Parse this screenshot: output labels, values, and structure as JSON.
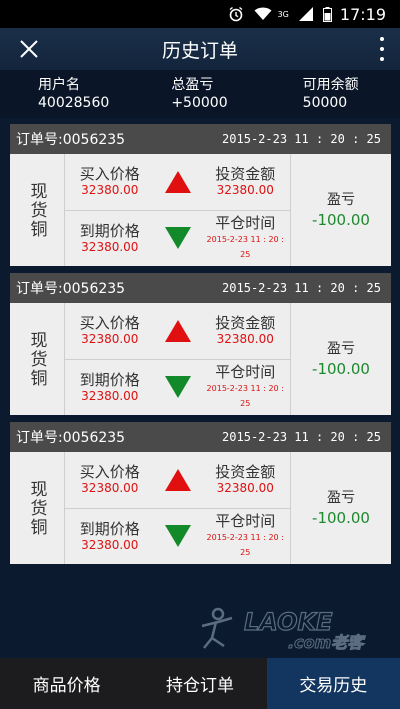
{
  "status_bar": {
    "time": "17:19",
    "network": "3G"
  },
  "header": {
    "title": "历史订单"
  },
  "summary": {
    "user": {
      "label": "用户名",
      "value": "40028560"
    },
    "profit": {
      "label": "总盈亏",
      "value": "+50000"
    },
    "balance": {
      "label": "可用余额",
      "value": "50000"
    }
  },
  "orders": [
    {
      "order_no": "订单号:0056235",
      "time": "2015-2-23 11 : 20 : 25",
      "product": "现货铜",
      "buy_label": "买入价格",
      "buy_value": "32380.00",
      "expire_label": "到期价格",
      "expire_value": "32380.00",
      "invest_label": "投资金额",
      "invest_value": "32380.00",
      "close_label": "平仓时间",
      "close_value": "2015-2-23 11 : 20 : 25",
      "pl_label": "盈亏",
      "pl_value": "-100.00"
    },
    {
      "order_no": "订单号:0056235",
      "time": "2015-2-23 11 : 20 : 25",
      "product": "现货铜",
      "buy_label": "买入价格",
      "buy_value": "32380.00",
      "expire_label": "到期价格",
      "expire_value": "32380.00",
      "invest_label": "投资金额",
      "invest_value": "32380.00",
      "close_label": "平仓时间",
      "close_value": "2015-2-23 11 : 20 : 25",
      "pl_label": "盈亏",
      "pl_value": "-100.00"
    },
    {
      "order_no": "订单号:0056235",
      "time": "2015-2-23 11 : 20 : 25",
      "product": "现货铜",
      "buy_label": "买入价格",
      "buy_value": "32380.00",
      "expire_label": "到期价格",
      "expire_value": "32380.00",
      "invest_label": "投资金额",
      "invest_value": "32380.00",
      "close_label": "平仓时间",
      "close_value": "2015-2-23 11 : 20 : 25",
      "pl_label": "盈亏",
      "pl_value": "-100.00"
    }
  ],
  "watermark": "LAOKE.com老客",
  "tabs": [
    {
      "label": "商品价格",
      "active": false
    },
    {
      "label": "持仓订单",
      "active": false
    },
    {
      "label": "交易历史",
      "active": true
    }
  ],
  "colors": {
    "up": "#e01010",
    "down": "#138a2a",
    "active_tab": "#12365f"
  }
}
